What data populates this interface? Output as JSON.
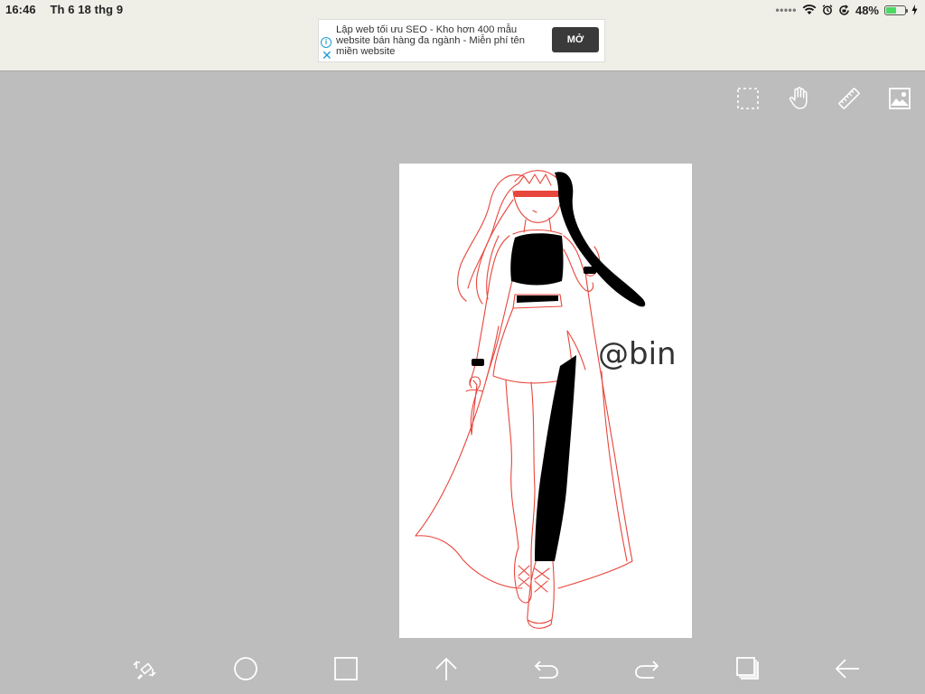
{
  "status_bar": {
    "time": "16:46",
    "date": "Th 6 18 thg 9",
    "battery": "48%",
    "battery_level": 0.48
  },
  "ad": {
    "text": "Lập web tối ưu SEO - Kho hơn 400 mẫu website bán hàng đa ngành - Miễn phí tên miền website",
    "button_label": "MỞ"
  },
  "canvas": {
    "signature": "@bin",
    "stroke_color": "#e8463c",
    "fill_color": "#000000",
    "background": "#ffffff"
  },
  "top_tools": [
    "selection-tool-icon",
    "pan-hand-icon",
    "ruler-icon",
    "image-icon"
  ],
  "bottom_tools": [
    "transform-icon",
    "ellipse-icon",
    "rectangle-icon",
    "upload-arrow-icon",
    "undo-icon",
    "redo-icon",
    "layers-icon",
    "back-arrow-icon"
  ],
  "colors": {
    "workspace": "#bdbdbd",
    "toolbar_icon": "#ffffff",
    "header": "#efefe7",
    "ad_button": "#3a3a3a"
  }
}
